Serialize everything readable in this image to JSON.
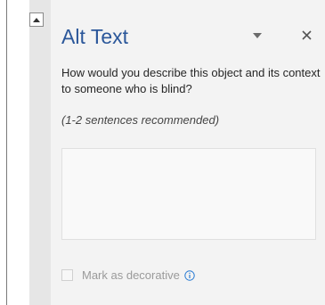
{
  "panel": {
    "title": "Alt Text",
    "description": "How would you describe this object and its context to someone who is blind?",
    "hint": "(1-2 sentences recommended)",
    "textarea_value": "",
    "decorative_label": "Mark as decorative",
    "decorative_checked": false
  },
  "icons": {
    "scroll_up": "triangle-up-icon",
    "dropdown": "triangle-down-icon",
    "close": "close-icon",
    "info": "info-icon"
  },
  "colors": {
    "title": "#2b579a",
    "panel_bg": "#f3f3f3",
    "info_accent": "#2b7cd3"
  }
}
